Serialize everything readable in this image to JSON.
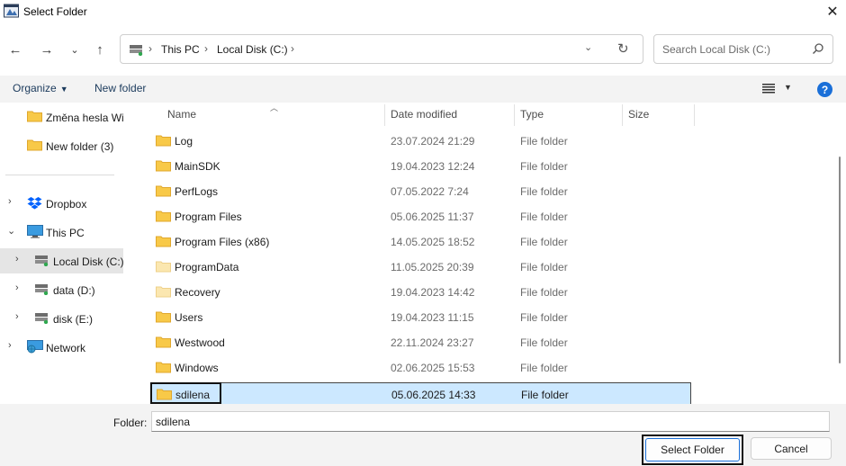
{
  "window": {
    "title": "Select Folder"
  },
  "address_bar": {
    "crumbs": [
      "This PC",
      "Local Disk (C:)"
    ]
  },
  "search": {
    "placeholder": "Search Local Disk (C:)"
  },
  "toolbar": {
    "organize_label": "Organize",
    "new_folder_label": "New folder"
  },
  "sidebar": {
    "items": [
      {
        "label": "Změna hesla Wi",
        "icon": "folder-icon"
      },
      {
        "label": "New folder (3)",
        "icon": "folder-icon"
      },
      {
        "label": "Dropbox",
        "icon": "dropbox-icon"
      },
      {
        "label": "This PC",
        "icon": "computer-icon"
      },
      {
        "label": "Local Disk (C:)",
        "icon": "drive-icon",
        "selected": true
      },
      {
        "label": "data (D:)",
        "icon": "drive-icon"
      },
      {
        "label": "disk (E:)",
        "icon": "drive-icon"
      },
      {
        "label": "Network",
        "icon": "network-icon"
      }
    ]
  },
  "columns": {
    "name": "Name",
    "date": "Date modified",
    "type": "Type",
    "size": "Size"
  },
  "files": [
    {
      "name": "Log",
      "date": "23.07.2024 21:29",
      "type": "File folder"
    },
    {
      "name": "MainSDK",
      "date": "19.04.2023 12:24",
      "type": "File folder"
    },
    {
      "name": "PerfLogs",
      "date": "07.05.2022 7:24",
      "type": "File folder"
    },
    {
      "name": "Program Files",
      "date": "05.06.2025 11:37",
      "type": "File folder"
    },
    {
      "name": "Program Files (x86)",
      "date": "14.05.2025 18:52",
      "type": "File folder"
    },
    {
      "name": "ProgramData",
      "date": "11.05.2025 20:39",
      "type": "File folder",
      "faded": true
    },
    {
      "name": "Recovery",
      "date": "19.04.2023 14:42",
      "type": "File folder",
      "faded": true
    },
    {
      "name": "Users",
      "date": "19.04.2023 11:15",
      "type": "File folder"
    },
    {
      "name": "Westwood",
      "date": "22.11.2024 23:27",
      "type": "File folder"
    },
    {
      "name": "Windows",
      "date": "02.06.2025 15:53",
      "type": "File folder"
    },
    {
      "name": "sdilena",
      "date": "05.06.2025 14:33",
      "type": "File folder",
      "selected": true
    }
  ],
  "footer": {
    "folder_label": "Folder:",
    "folder_value": "sdilena",
    "select_label": "Select Folder",
    "cancel_label": "Cancel"
  },
  "colors": {
    "accent": "#1a6fd8",
    "selection": "#cce8ff",
    "folder": "#f8c948"
  }
}
